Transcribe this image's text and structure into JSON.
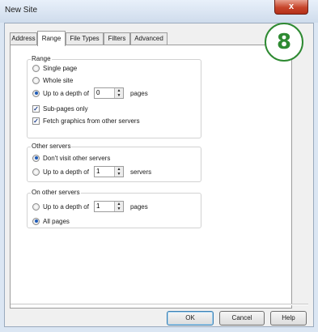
{
  "window": {
    "title": "New Site",
    "close_label": "x"
  },
  "tabs": [
    {
      "label": "Address"
    },
    {
      "label": "Range"
    },
    {
      "label": "File Types"
    },
    {
      "label": "Filters"
    },
    {
      "label": "Advanced"
    }
  ],
  "step_badge": "8",
  "range_group": {
    "title": "Range",
    "single_page": "Single page",
    "whole_site": "Whole site",
    "depth_label": "Up to a depth of",
    "depth_value": "0",
    "depth_unit": "pages",
    "sub_pages_only": "Sub-pages only",
    "fetch_graphics": "Fetch graphics from other servers",
    "selected": "depth"
  },
  "other_servers_group": {
    "title": "Other servers",
    "dont_visit": "Don't visit other servers",
    "depth_label": "Up to a depth of",
    "depth_value": "1",
    "depth_unit": "servers",
    "selected": "dont_visit"
  },
  "on_other_servers_group": {
    "title": "On other servers",
    "depth_label": "Up to a depth of",
    "depth_value": "1",
    "depth_unit": "pages",
    "all_pages": "All pages",
    "selected": "all_pages"
  },
  "buttons": {
    "ok": "OK",
    "cancel": "Cancel",
    "help": "Help"
  },
  "colors": {
    "accent_radio": "#1e5bb8",
    "badge_green": "#2e8a32",
    "close_red": "#c6442a"
  }
}
